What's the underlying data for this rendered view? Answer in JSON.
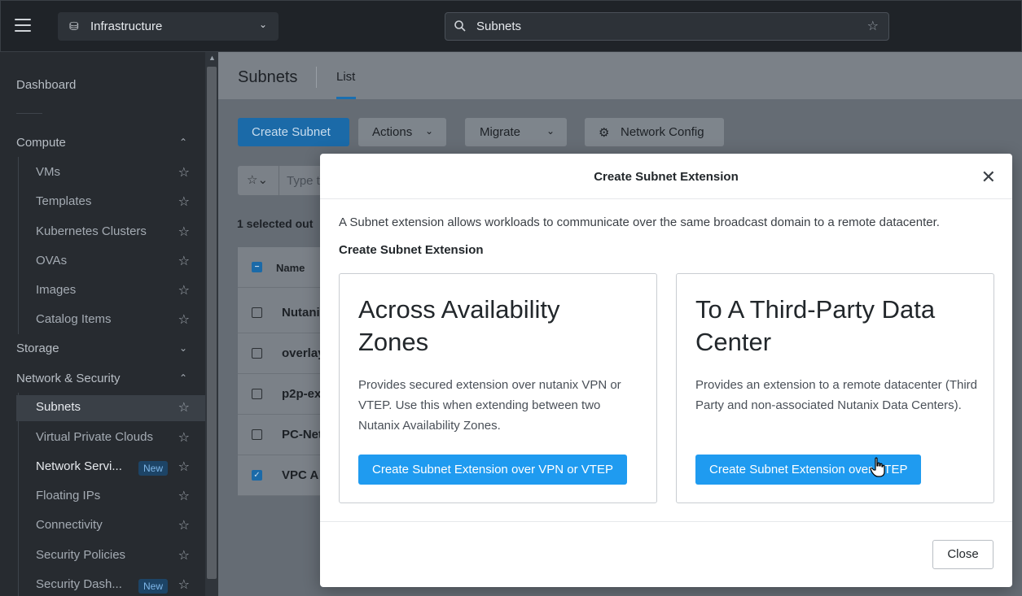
{
  "topbar": {
    "app_name": "Infrastructure",
    "search_value": "Subnets"
  },
  "sidebar": {
    "dashboard": "Dashboard",
    "sections": [
      {
        "label": "Compute",
        "items": [
          "VMs",
          "Templates",
          "Kubernetes Clusters",
          "OVAs",
          "Images",
          "Catalog Items"
        ]
      },
      {
        "label": "Storage",
        "items": []
      },
      {
        "label": "Network & Security",
        "items": [
          "Subnets",
          "Virtual Private Clouds",
          "Network Servi...",
          "Floating IPs",
          "Connectivity",
          "Security Policies",
          "Security Dash..."
        ]
      }
    ],
    "new_badge": "New"
  },
  "main": {
    "title": "Subnets",
    "tab": "List",
    "buttons": {
      "create": "Create Subnet",
      "actions": "Actions",
      "migrate": "Migrate",
      "network_config": "Network Config"
    },
    "filter_placeholder": "Type t",
    "selected_text": "1 selected out",
    "table": {
      "header": "Name",
      "rows": [
        "Nutani",
        "overlay",
        "p2p-ex",
        "PC-Net",
        "VPC A"
      ]
    }
  },
  "modal": {
    "title": "Create Subnet Extension",
    "description": "A Subnet extension allows workloads to communicate over the same broadcast domain to a remote datacenter.",
    "subtitle": "Create Subnet Extension",
    "cards": [
      {
        "title": "Across Availability Zones",
        "text": "Provides secured extension over nutanix VPN or VTEP. Use this when extending between two Nutanix Availability Zones.",
        "button": "Create Subnet Extension over VPN or VTEP"
      },
      {
        "title": "To A Third-Party Data Center",
        "text": "Provides an extension to a remote datacenter (Third Party and non-associated Nutanix Data Centers).",
        "button": "Create Subnet Extension over VTEP"
      }
    ],
    "close_label": "Close"
  }
}
